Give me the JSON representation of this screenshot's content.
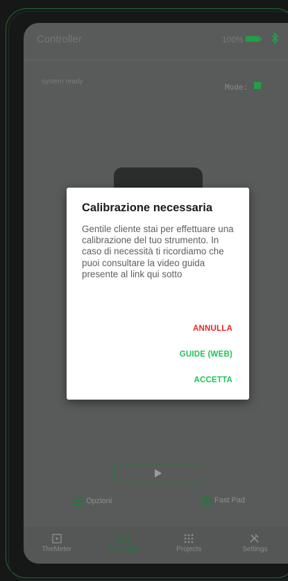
{
  "app": {
    "title": "Controller",
    "battery_percent": "100%",
    "status_text": "system ready",
    "mode_label": "Mode:"
  },
  "colors": {
    "accent_green": "#22a048",
    "cancel_red": "#ee2424",
    "action_green": "#1fc25a"
  },
  "controls": {
    "options_label": "Opzioni",
    "fastpad_label": "Fast Pad"
  },
  "nav": {
    "items": [
      {
        "label": "TheMeter",
        "icon": "meter-icon",
        "active": false
      },
      {
        "label": "Controller",
        "icon": "gamepad-icon",
        "active": true
      },
      {
        "label": "Projects",
        "icon": "grid-icon",
        "active": false
      },
      {
        "label": "Settings",
        "icon": "tools-icon",
        "active": false
      }
    ]
  },
  "dialog": {
    "title": "Calibrazione necessaria",
    "body": "Gentile cliente stai per effettuare una calibrazione del tuo strumento. In caso di necessità ti ricordiamo che puoi consultare la video guida presente al link qui sotto",
    "cancel_label": "ANNULLA",
    "guide_label": "GUIDE (WEB)",
    "accept_label": "ACCETTA"
  }
}
